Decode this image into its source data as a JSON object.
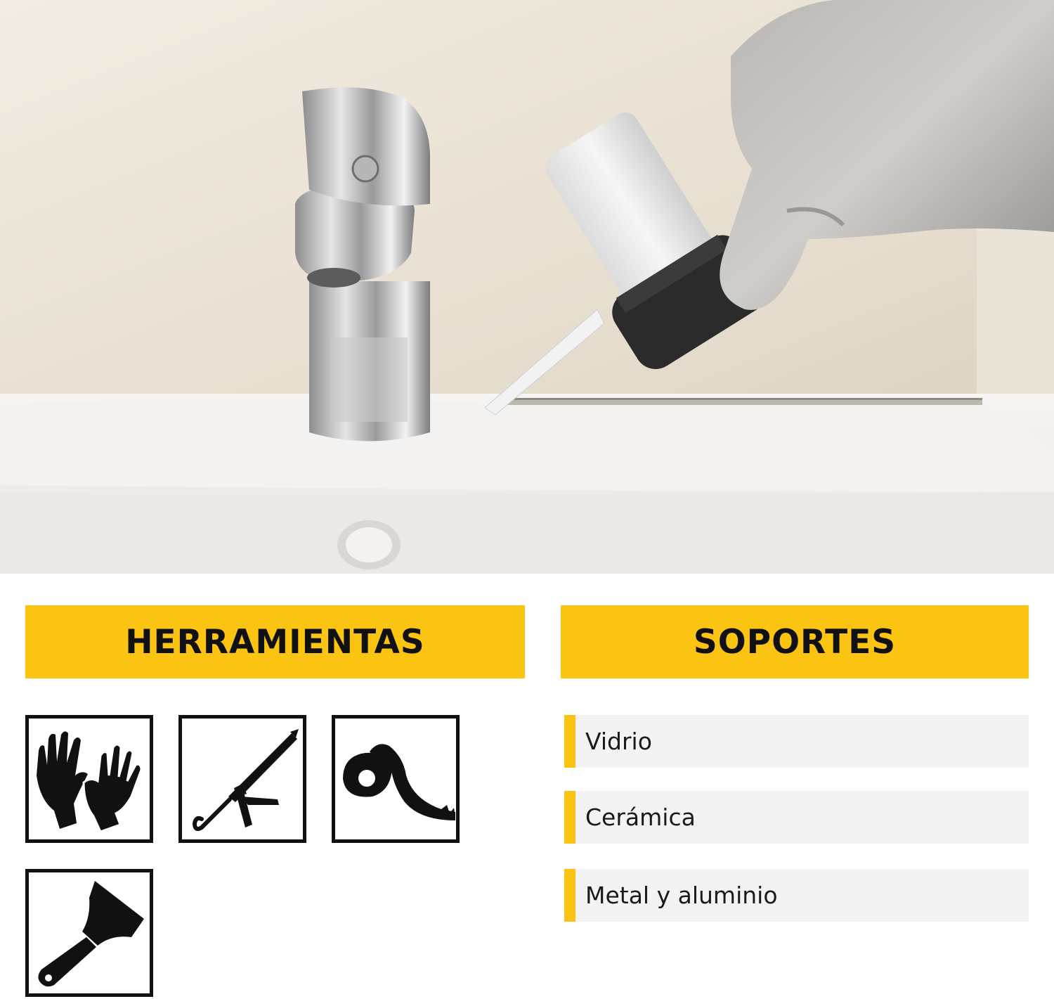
{
  "photo": {
    "subject": "sealant-application-photo"
  },
  "headers": {
    "tools": "HERRAMIENTAS",
    "supports": "SOPORTES"
  },
  "tools": {
    "icons": [
      "gloves-icon",
      "caulking-gun-icon",
      "masking-tape-icon",
      "putty-knife-icon"
    ]
  },
  "supports": {
    "items": [
      "Vidrio",
      "Cerámica",
      "Metal y aluminio"
    ]
  },
  "colors": {
    "accent": "#fbc413",
    "text": "#111111",
    "row_bg": "#f3f3f3"
  }
}
